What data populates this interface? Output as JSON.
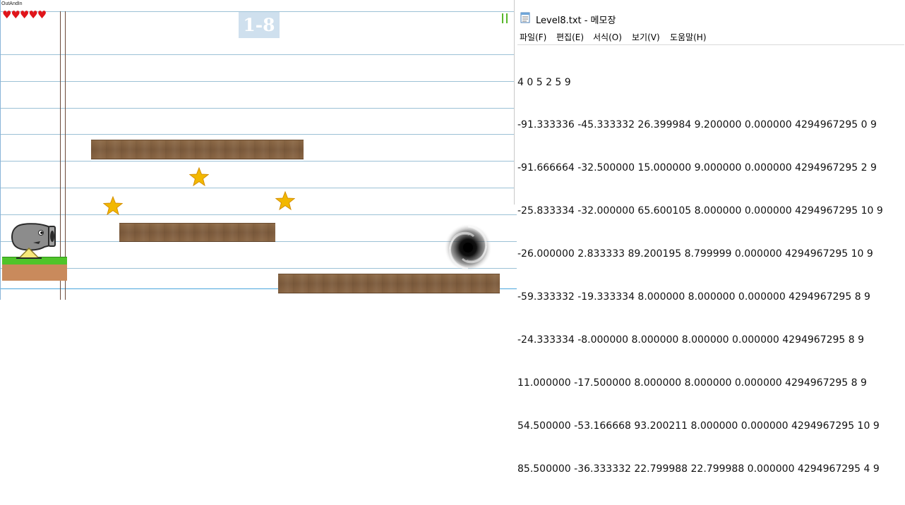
{
  "game": {
    "window_title": "OutAndIn",
    "hearts": "♥♥♥♥♥",
    "level_label": "1-8",
    "colors": {
      "plank": "#7b5a3c",
      "grass": "#4fc42a",
      "dirt": "#c98a5c",
      "star": "#f2b800",
      "heart": "#e0151b"
    },
    "icons": [
      "heart-icon",
      "star-icon",
      "vortex-icon",
      "cannon-icon"
    ]
  },
  "notepad": {
    "title": "Level8.txt - 메모장",
    "menu": [
      {
        "label": "파일(F)"
      },
      {
        "label": "편집(E)"
      },
      {
        "label": "서식(O)"
      },
      {
        "label": "보기(V)"
      },
      {
        "label": "도움말(H)"
      }
    ],
    "lines": [
      "4 0 5 2 5 9",
      "-91.333336 -45.333332 26.399984 9.200000 0.000000 4294967295 0 9",
      "-91.666664 -32.500000 15.000000 9.000000 0.000000 4294967295 2 9",
      "-25.833334 -32.000000 65.600105 8.000000 0.000000 4294967295 10 9",
      "-26.000000 2.833333 89.200195 8.799999 0.000000 4294967295 10 9",
      "-59.333332 -19.333334 8.000000 8.000000 0.000000 4294967295 8 9",
      "-24.333334 -8.000000 8.000000 8.000000 0.000000 4294967295 8 9",
      "11.000000 -17.500000 8.000000 8.000000 0.000000 4294967295 8 9",
      "54.500000 -53.166668 93.200211 8.000000 0.000000 4294967295 10 9",
      "85.500000 -36.333332 22.799988 22.799988 0.000000 4294967295 4 9"
    ]
  }
}
